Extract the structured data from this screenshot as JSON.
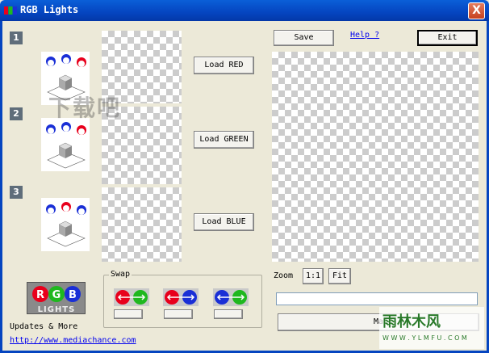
{
  "window": {
    "title": "RGB Lights",
    "close_label": "X"
  },
  "panels": [
    {
      "number": "1",
      "button_label": "Load RED"
    },
    {
      "number": "2",
      "button_label": "Load GREEN"
    },
    {
      "number": "3",
      "button_label": "Load BLUE"
    }
  ],
  "toolbar": {
    "save_label": "Save",
    "help_label": "Help ?",
    "exit_label": "Exit"
  },
  "zoom": {
    "label": "Zoom",
    "one_to_one": "1:1",
    "fit": "Fit"
  },
  "swap": {
    "legend": "Swap",
    "pairs": [
      "red-green",
      "red-blue",
      "blue-green"
    ]
  },
  "footer": {
    "updates_label": "Updates & More",
    "url": "http://www.mediachance.com",
    "make_label": "Ma"
  },
  "logo": {
    "letters": [
      "R",
      "G",
      "B"
    ],
    "text": "LIGHTS"
  },
  "watermark": {
    "top_left": "下载吧",
    "bottom_right": "雨林木风",
    "bottom_right_url": "W W W . Y L M F U . C O M"
  },
  "colors": {
    "red": "#e8001c",
    "green": "#1fb81f",
    "blue": "#1a2fd6",
    "titlebar": "#0545c0"
  }
}
